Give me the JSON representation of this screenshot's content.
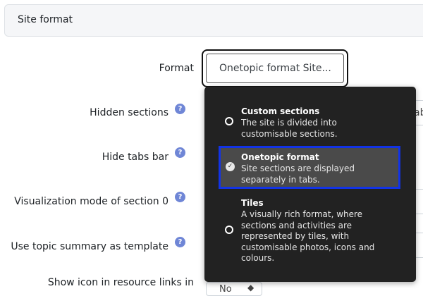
{
  "section": {
    "title": "Site format"
  },
  "form": {
    "format_label": "Format",
    "format_value": "Onetopic format Site...",
    "hidden_sections_label": "Hidden sections",
    "hide_tabs_bar_label": "Hide tabs bar",
    "visualization_label": "Visualization mode of section 0",
    "topic_summary_label": "Use topic summary as template",
    "show_icon_label": "Show icon in resource links in",
    "partial_field_text": "ab",
    "bottom_select_value": "No",
    "bottom_select_caret": "◆",
    "help_glyph": "?"
  },
  "dropdown": {
    "options": [
      {
        "name": "Custom sections",
        "description": "The site is divided into customisable sections.",
        "selected": false
      },
      {
        "name": "Onetopic format",
        "description": "Site sections are displayed separately in tabs.",
        "selected": true
      },
      {
        "name": "Tiles",
        "description": "A visually rich format, where sections and activities are represented by tiles, with customisable photos, icons and colours.",
        "selected": false
      }
    ]
  },
  "colors": {
    "accent_blue": "#1233e6",
    "help_icon": "#6f86d6",
    "dropdown_bg": "#222222"
  }
}
